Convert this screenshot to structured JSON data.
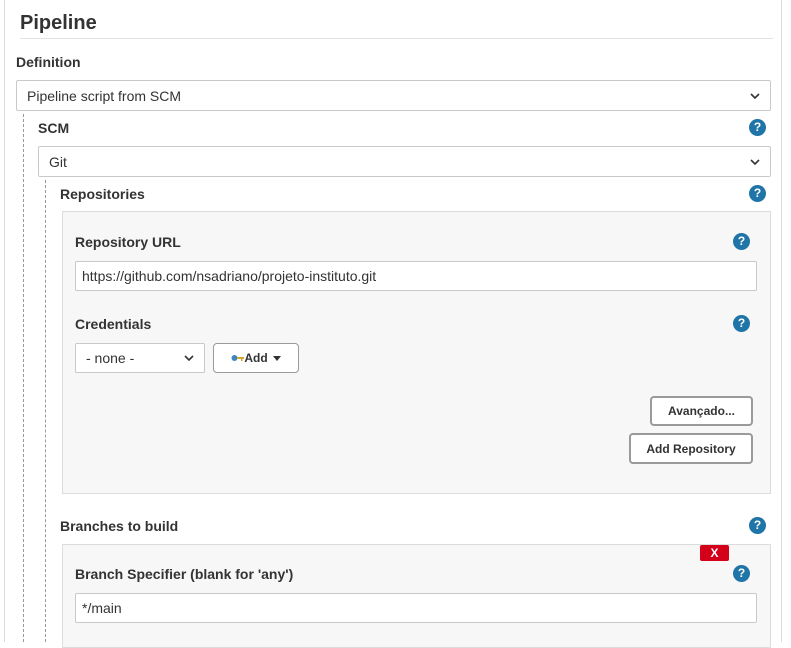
{
  "pipeline": {
    "title": "Pipeline",
    "definition": {
      "label": "Definition",
      "selected": "Pipeline script from SCM"
    },
    "scm": {
      "label": "SCM",
      "selected": "Git"
    },
    "repositories": {
      "label": "Repositories",
      "repository_url": {
        "label": "Repository URL",
        "value": "https://github.com/nsadriano/projeto-instituto.git"
      },
      "credentials": {
        "label": "Credentials",
        "selected": "- none -",
        "add_label": "Add"
      },
      "advanced_label": "Avançado...",
      "add_repository_label": "Add Repository"
    },
    "branches": {
      "label": "Branches to build",
      "delete_label": "X",
      "branch_specifier": {
        "label": "Branch Specifier (blank for 'any')",
        "value": "*/main"
      }
    },
    "help_symbol": "?"
  },
  "colors": {
    "help": "#1f74a8",
    "delete": "#d4001a"
  },
  "icons": {
    "select": "chevron-down-icon",
    "help": "help-icon",
    "credentials": "key-icon",
    "add_menu": "caret-down-icon"
  }
}
